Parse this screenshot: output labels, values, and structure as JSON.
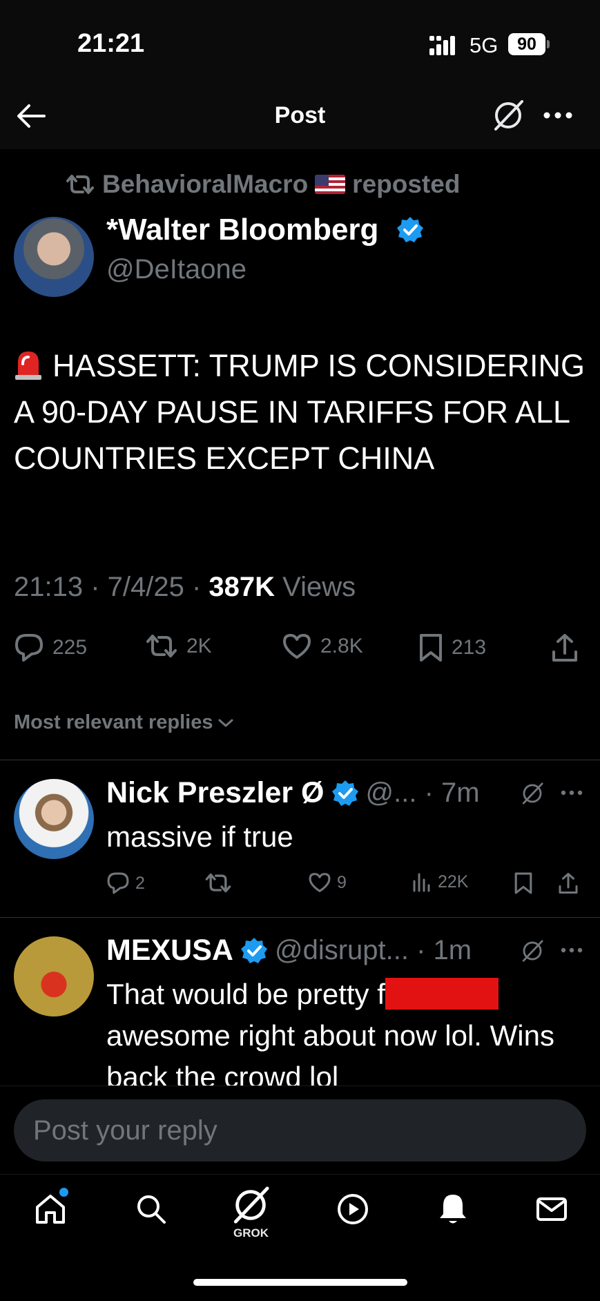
{
  "status_bar": {
    "time": "21:21",
    "network": "5G",
    "battery": "90"
  },
  "header": {
    "title": "Post"
  },
  "post": {
    "repost_user": "BehavioralMacro",
    "repost_suffix": "reposted",
    "author_name": "*Walter Bloomberg",
    "author_handle": "@DeItaone",
    "text": "HASSETT: TRUMP IS CONSIDERING A 90-DAY PAUSE IN TARIFFS FOR ALL COUNTRIES EXCEPT CHINA",
    "meta_time": "21:13 · 7/4/25 · ",
    "views_count": "387K",
    "views_label": " Views",
    "replies": "225",
    "reposts": "2K",
    "likes": "2.8K",
    "bookmarks": "213"
  },
  "sort": {
    "label": "Most relevant replies"
  },
  "replies": [
    {
      "name": "Nick Preszler Ø",
      "handle": "@... · 7m",
      "text": "massive if true",
      "reply_count": "2",
      "like_count": "9",
      "views": "22K"
    },
    {
      "name": "MEXUSA",
      "handle": "@disrupt... · 1m",
      "text_before": "That would be pretty f",
      "text_after": "awesome right about now lol. Wins back the crowd lol"
    }
  ],
  "reply_box": {
    "placeholder": "Post your reply"
  },
  "tabbar": {
    "grok_label": "GROK"
  },
  "colors": {
    "accent": "#1d9bf0",
    "muted": "#71767b",
    "background": "#000000",
    "redaction": "#e31212"
  }
}
